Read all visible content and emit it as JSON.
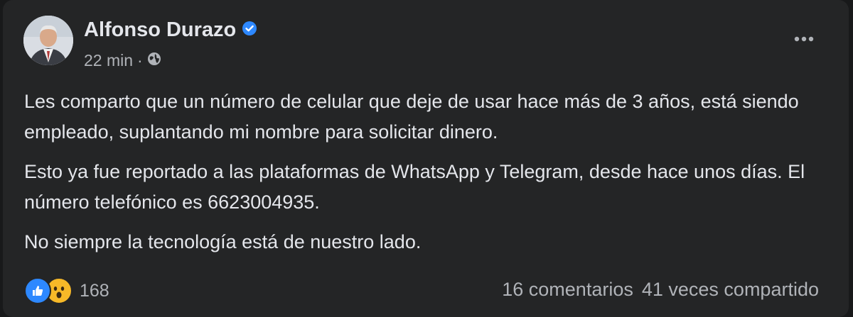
{
  "post": {
    "author": "Alfonso Durazo",
    "verified_icon": "verified-badge-icon",
    "time": "22 min",
    "separator": "·",
    "audience_icon": "globe-icon",
    "more_icon": "more-options-icon",
    "paragraphs": [
      "Les comparto que un número de celular que deje de usar hace más de 3 años, está siendo empleado, suplantando mi nombre para solicitar dinero.",
      "Esto ya fue reportado a las plataformas de WhatsApp y Telegram, desde hace unos días. El número telefónico es 6623004935.",
      "No siempre la tecnología está de nuestro lado."
    ]
  },
  "footer": {
    "reaction_icons": [
      "like-reaction-icon",
      "wow-reaction-icon"
    ],
    "reactions_count": "168",
    "comments": "16 comentarios",
    "shares": "41 veces compartido"
  },
  "colors": {
    "background": "#242526",
    "text": "#e4e6eb",
    "secondary_text": "#b0b3b8",
    "accent_blue": "#2d88ff",
    "wow_yellow": "#f7b928"
  }
}
